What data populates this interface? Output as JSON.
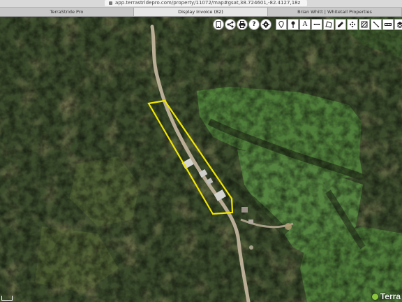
{
  "browser": {
    "url": "app.terrastridepro.com/property/11072/map#gsat,38.724601,-82.4127,18z",
    "tabs": [
      {
        "label": "TerraStride Pro",
        "active": false
      },
      {
        "label": "Display Invoice (82)",
        "active": true
      },
      {
        "label": "Brian Whitt | Whitetail Properties",
        "active": false
      }
    ]
  },
  "toolbar": {
    "left_icons": [
      "mobile-icon",
      "share-icon",
      "print-icon",
      "help-icon",
      "settings-icon"
    ],
    "right_icons": [
      "marker-icon",
      "pin-icon",
      "text-icon",
      "line-icon",
      "polygon-icon",
      "edit-icon",
      "move-icon",
      "fill-icon",
      "measure-icon",
      "ruler-icon",
      "layers-icon"
    ]
  },
  "map": {
    "type": "satellite",
    "boundary_color": "#f2e600",
    "colors": {
      "forest": "#3b4c2c",
      "field": "#4f7d3a",
      "road": "#b9ad95"
    }
  },
  "branding": {
    "logo_text": "Terra"
  }
}
